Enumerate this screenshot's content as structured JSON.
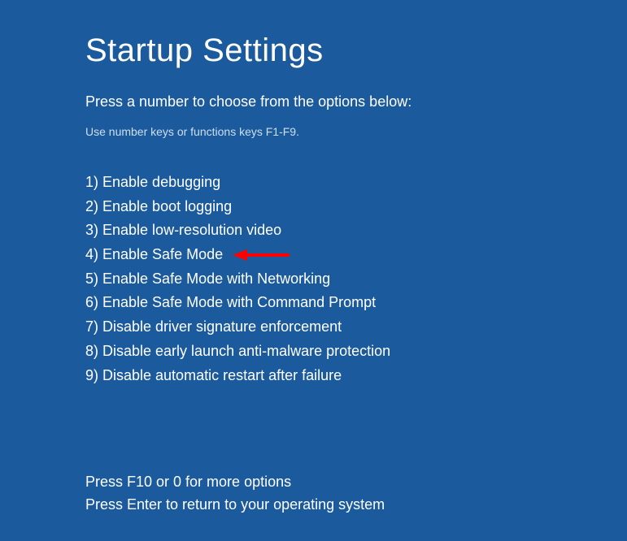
{
  "title": "Startup Settings",
  "instruction": "Press a number to choose from the options below:",
  "hint": "Use number keys or functions keys F1-F9.",
  "options": [
    "1) Enable debugging",
    "2) Enable boot logging",
    "3) Enable low-resolution video",
    "4) Enable Safe Mode",
    "5) Enable Safe Mode with Networking",
    "6) Enable Safe Mode with Command Prompt",
    "7) Disable driver signature enforcement",
    "8) Disable early launch anti-malware protection",
    "9) Disable automatic restart after failure"
  ],
  "highlighted_option_index": 3,
  "footer_more": "Press F10 or 0 for more options",
  "footer_return": "Press Enter to return to your operating system"
}
